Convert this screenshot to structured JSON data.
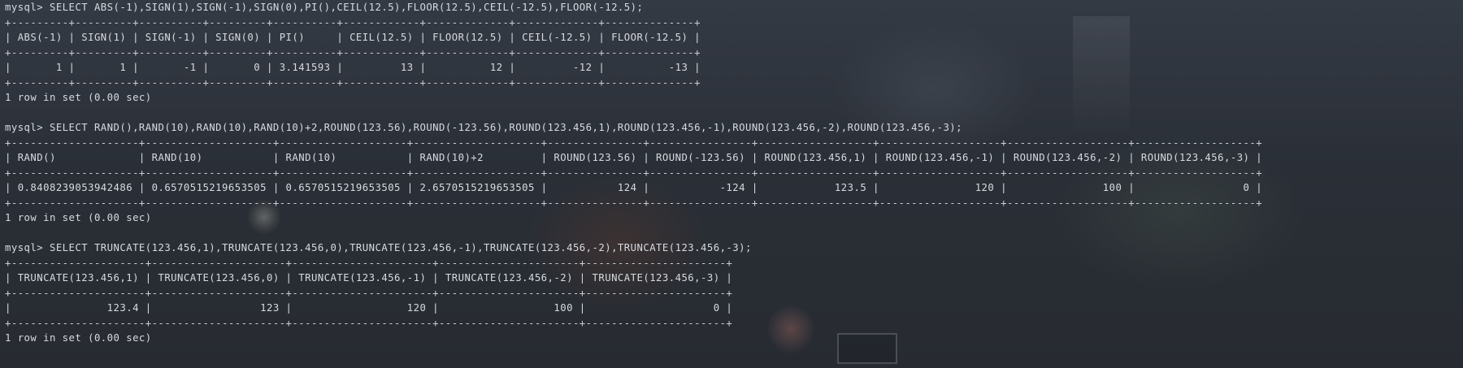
{
  "terminal": {
    "lines": [
      "mysql> SELECT ABS(-1),SIGN(1),SIGN(-1),SIGN(0),PI(),CEIL(12.5),FLOOR(12.5),CEIL(-12.5),FLOOR(-12.5);",
      "+---------+---------+----------+---------+----------+------------+-------------+-------------+--------------+",
      "| ABS(-1) | SIGN(1) | SIGN(-1) | SIGN(0) | PI()     | CEIL(12.5) | FLOOR(12.5) | CEIL(-12.5) | FLOOR(-12.5) |",
      "+---------+---------+----------+---------+----------+------------+-------------+-------------+--------------+",
      "|       1 |       1 |       -1 |       0 | 3.141593 |         13 |          12 |         -12 |          -13 |",
      "+---------+---------+----------+---------+----------+------------+-------------+-------------+--------------+",
      "1 row in set (0.00 sec)",
      "",
      "mysql> SELECT RAND(),RAND(10),RAND(10),RAND(10)+2,ROUND(123.56),ROUND(-123.56),ROUND(123.456,1),ROUND(123.456,-1),ROUND(123.456,-2),ROUND(123.456,-3);",
      "+--------------------+--------------------+--------------------+--------------------+---------------+----------------+------------------+-------------------+-------------------+-------------------+",
      "| RAND()             | RAND(10)           | RAND(10)           | RAND(10)+2         | ROUND(123.56) | ROUND(-123.56) | ROUND(123.456,1) | ROUND(123.456,-1) | ROUND(123.456,-2) | ROUND(123.456,-3) |",
      "+--------------------+--------------------+--------------------+--------------------+---------------+----------------+------------------+-------------------+-------------------+-------------------+",
      "| 0.8408239053942486 | 0.6570515219653505 | 0.6570515219653505 | 2.6570515219653505 |           124 |           -124 |            123.5 |               120 |               100 |                 0 |",
      "+--------------------+--------------------+--------------------+--------------------+---------------+----------------+------------------+-------------------+-------------------+-------------------+",
      "1 row in set (0.00 sec)",
      "",
      "mysql> SELECT TRUNCATE(123.456,1),TRUNCATE(123.456,0),TRUNCATE(123.456,-1),TRUNCATE(123.456,-2),TRUNCATE(123.456,-3);",
      "+---------------------+---------------------+----------------------+----------------------+----------------------+",
      "| TRUNCATE(123.456,1) | TRUNCATE(123.456,0) | TRUNCATE(123.456,-1) | TRUNCATE(123.456,-2) | TRUNCATE(123.456,-3) |",
      "+---------------------+---------------------+----------------------+----------------------+----------------------+",
      "|               123.4 |                 123 |                  120 |                  100 |                    0 |",
      "+---------------------+---------------------+----------------------+----------------------+----------------------+",
      "1 row in set (0.00 sec)"
    ]
  },
  "colors": {
    "text": "#d7dbe0",
    "background": "#2b3038"
  }
}
